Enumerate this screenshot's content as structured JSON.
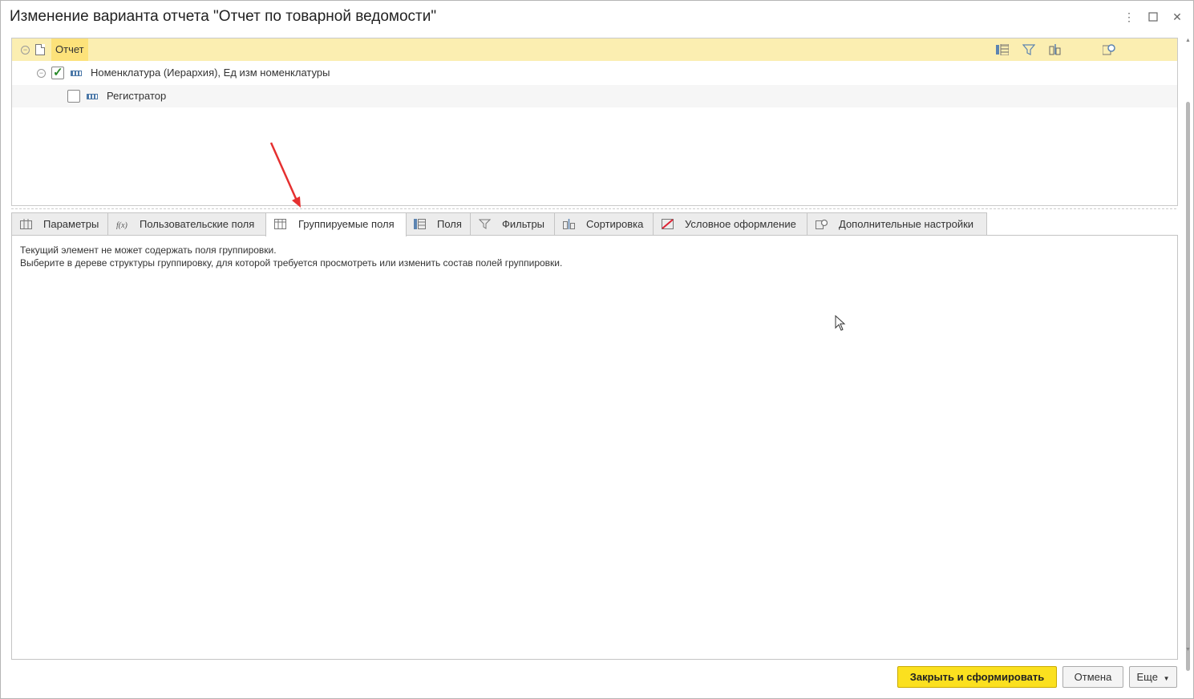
{
  "window": {
    "title": "Изменение варианта отчета \"Отчет по товарной ведомости\"",
    "menu_icon": "more-vertical-icon",
    "maximize_icon": "maximize-icon",
    "close_icon": "close-icon"
  },
  "tree": {
    "root_label": "Отчет",
    "items": [
      {
        "label": "Номенклатура (Иерархия), Ед изм номенклатуры",
        "checked": true
      },
      {
        "label": "Регистратор",
        "checked": false
      }
    ],
    "toolbar_icons": [
      "selected-fields-icon",
      "filter-icon",
      "sort-icon",
      "settings-icon"
    ]
  },
  "tabs": [
    {
      "label": "Параметры",
      "icon": "params-icon"
    },
    {
      "label": "Пользовательские поля",
      "icon": "custom-fields-icon"
    },
    {
      "label": "Группируемые поля",
      "icon": "grouping-fields-icon",
      "active": true
    },
    {
      "label": "Поля",
      "icon": "fields-icon"
    },
    {
      "label": "Фильтры",
      "icon": "filter-icon"
    },
    {
      "label": "Сортировка",
      "icon": "sort-icon"
    },
    {
      "label": "Условное оформление",
      "icon": "conditional-format-icon"
    },
    {
      "label": "Дополнительные настройки",
      "icon": "advanced-settings-icon"
    }
  ],
  "panel": {
    "line1": "Текущий элемент не может содержать поля группировки.",
    "line2": "Выберите в дереве структуры группировку, для которой требуется просмотреть или изменить состав полей группировки."
  },
  "buttons": {
    "primary": "Закрыть и сформировать",
    "cancel": "Отмена",
    "more": "Еще"
  },
  "colors": {
    "selected_row": "#fbeeb1",
    "selected_label": "#fde27a",
    "primary_button": "#fbe01f",
    "annotation_arrow": "#e53030"
  }
}
